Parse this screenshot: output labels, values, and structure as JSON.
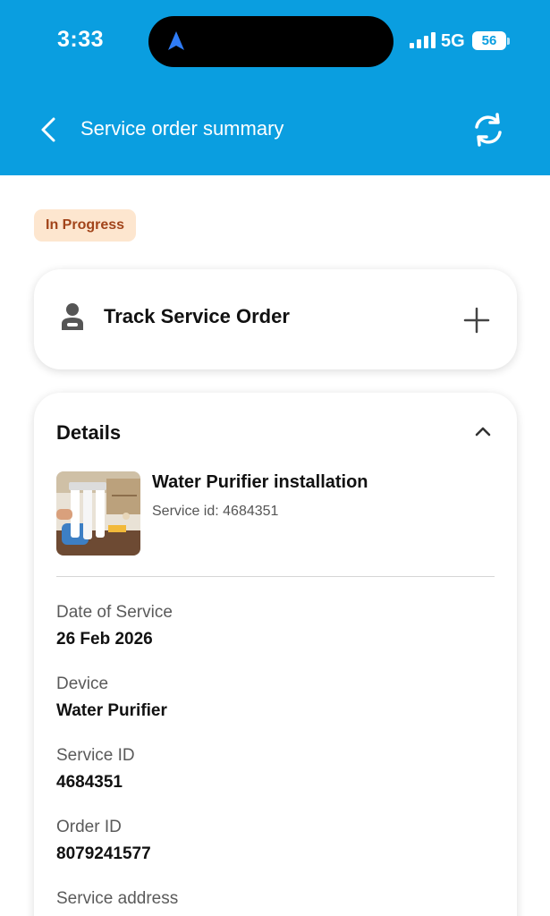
{
  "status_bar": {
    "time": "3:33",
    "network": "5G",
    "battery": "56"
  },
  "header": {
    "title": "Service order summary",
    "back_icon": "chevron-left-icon",
    "refresh_icon": "refresh-icon",
    "background_color": "#0a9ee0"
  },
  "order_status": {
    "label": "In Progress",
    "color": "#a2441a",
    "background": "#fde6cf"
  },
  "track_card": {
    "title": "Track Service Order",
    "icon": "person-icon",
    "expand_icon": "plus-icon"
  },
  "details": {
    "title": "Details",
    "collapse_icon": "chevron-up-icon",
    "product": {
      "name": "Water Purifier installation",
      "service_id_text": "Service id: 4684351"
    },
    "fields": [
      {
        "label": "Date of Service",
        "value": "26 Feb 2026"
      },
      {
        "label": "Device",
        "value": "Water Purifier"
      },
      {
        "label": "Service ID",
        "value": "4684351"
      },
      {
        "label": "Order ID",
        "value": "8079241577"
      },
      {
        "label": "Service address",
        "value": ""
      }
    ]
  }
}
